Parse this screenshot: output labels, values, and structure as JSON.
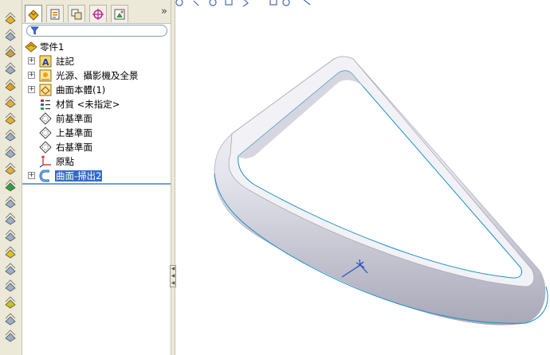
{
  "window": {
    "title": ""
  },
  "command_bar": {
    "tools": [
      "extrude-boss-icon",
      "revolve-boss-icon",
      "swept-boss-icon",
      "loft-boss-icon",
      "sweep-icon",
      "shell-icon",
      "cube-icon",
      "cut-icon",
      "hole-icon",
      "fillet-icon",
      "box-green-icon",
      "chamfer-icon",
      "wrap-icon",
      "dome-icon",
      "shape-icon",
      "draft-icon",
      "rib-icon",
      "mirror-icon",
      "pattern-icon",
      "cylinder-icon"
    ]
  },
  "panel": {
    "tabs": [
      {
        "icon": "feature-manager-icon",
        "active": true
      },
      {
        "icon": "property-manager-icon",
        "active": false
      },
      {
        "icon": "configuration-manager-icon",
        "active": false
      },
      {
        "icon": "dimxpert-icon",
        "active": false
      },
      {
        "icon": "display-manager-icon",
        "active": false
      }
    ],
    "more_label": "»",
    "filter": {
      "value": "",
      "placeholder": ""
    }
  },
  "tree": {
    "root": {
      "label": "零件1",
      "icon": "part-icon"
    },
    "items": [
      {
        "label": "註記",
        "icon": "annotations-icon",
        "expandable": true,
        "selected": false
      },
      {
        "label": "光源、攝影機及全景",
        "icon": "lights-icon",
        "expandable": true,
        "selected": false
      },
      {
        "label": "曲面本體(1)",
        "icon": "surface-bodies-icon",
        "expandable": true,
        "selected": false
      },
      {
        "label": "材質 <未指定>",
        "icon": "material-icon",
        "expandable": false,
        "selected": false
      },
      {
        "label": "前基準面",
        "icon": "plane-icon",
        "expandable": false,
        "selected": false
      },
      {
        "label": "上基準面",
        "icon": "plane-icon",
        "expandable": false,
        "selected": false
      },
      {
        "label": "右基準面",
        "icon": "plane-icon",
        "expandable": false,
        "selected": false
      },
      {
        "label": "原點",
        "icon": "origin-icon",
        "expandable": false,
        "selected": false
      },
      {
        "label": "曲面-掃出2",
        "icon": "surface-sweep-icon",
        "expandable": true,
        "selected": true
      }
    ]
  },
  "viewport": {
    "model": "swept-surface",
    "colors": {
      "surface": "#e6e6ee",
      "edge_highlight": "#1a8fc8",
      "triad": "#2a4fc0"
    }
  }
}
